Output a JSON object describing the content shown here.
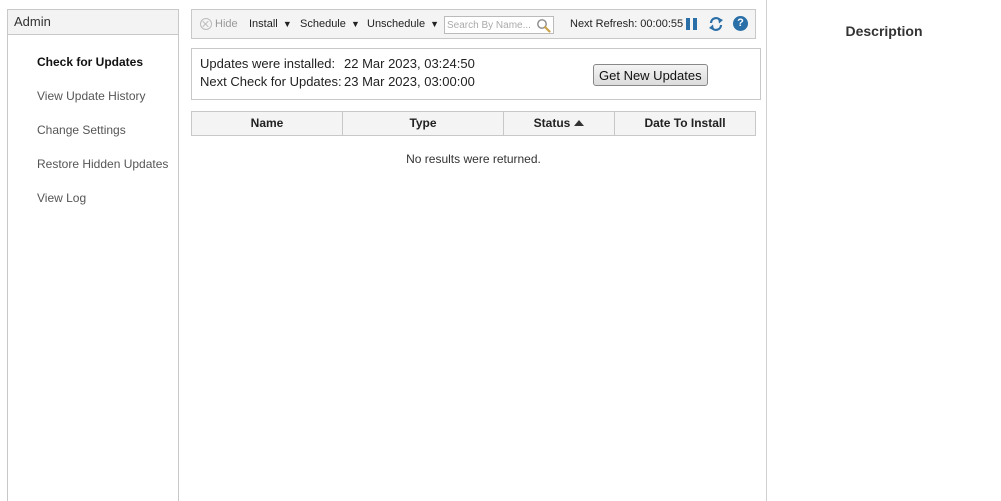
{
  "admin": {
    "title": "Admin",
    "nav": [
      {
        "label": "Check for Updates",
        "active": true
      },
      {
        "label": "View Update History",
        "active": false
      },
      {
        "label": "Change Settings",
        "active": false
      },
      {
        "label": "Restore Hidden Updates",
        "active": false
      },
      {
        "label": "View Log",
        "active": false
      }
    ]
  },
  "toolbar": {
    "hide_label": "Hide",
    "install_label": "Install",
    "schedule_label": "Schedule",
    "unschedule_label": "Unschedule",
    "caret": "▼",
    "search_placeholder": "Search By Name...",
    "next_refresh_label": "Next Refresh: 00:00:55",
    "help_glyph": "?",
    "icons": {
      "pause": "pause-icon",
      "refresh": "refresh-icon",
      "help": "help-icon",
      "search": "search-icon"
    },
    "accent_color": "#2a6fa8"
  },
  "info": {
    "installed_label": "Updates were installed:",
    "installed_value": "22 Mar 2023, 03:24:50",
    "next_check_label": "Next Check for Updates:",
    "next_check_value": "23 Mar 2023, 03:00:00",
    "get_updates_button": "Get New Updates"
  },
  "table": {
    "columns": [
      "Name",
      "Type",
      "Status",
      "Date To Install"
    ],
    "sorted_column": "Status",
    "sort_direction": "ascending",
    "empty_message": "No results were returned.",
    "rows": []
  },
  "description": {
    "title": "Description"
  }
}
